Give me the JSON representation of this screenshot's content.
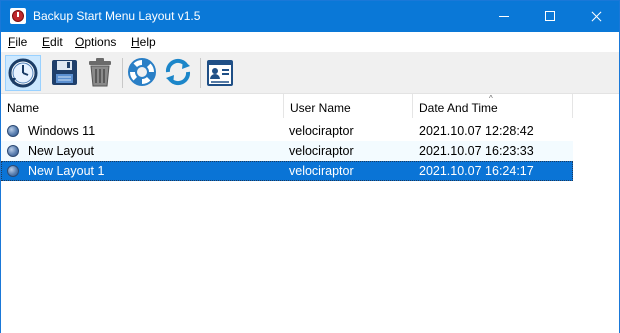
{
  "window": {
    "title": "Backup Start Menu Layout v1.5"
  },
  "menu": {
    "items": [
      {
        "key": "F",
        "rest": "ile"
      },
      {
        "key": "E",
        "rest": "dit"
      },
      {
        "key": "O",
        "rest": "ptions"
      },
      {
        "key": "H",
        "rest": "elp"
      }
    ]
  },
  "toolbar": {
    "buttons": [
      "backup-icon",
      "save-icon",
      "delete-icon",
      "restore-icon",
      "refresh-icon",
      "properties-icon"
    ]
  },
  "list": {
    "columns": [
      "Name",
      "User Name",
      "Date And Time"
    ],
    "sort_indicator": "^",
    "rows": [
      {
        "name": "Windows 11",
        "user": "velociraptor",
        "date": "2021.10.07 12:28:42"
      },
      {
        "name": "New Layout",
        "user": "velociraptor",
        "date": "2021.10.07 16:23:33"
      },
      {
        "name": "New Layout 1",
        "user": "velociraptor",
        "date": "2021.10.07 16:24:17"
      }
    ],
    "selected_index": 2
  },
  "colors": {
    "titlebar": "#0a78d7",
    "selection": "#0a74d6",
    "alt_row": "#f3fbff"
  }
}
